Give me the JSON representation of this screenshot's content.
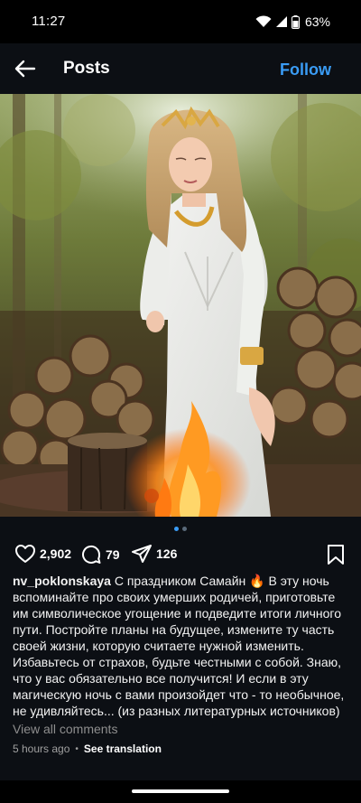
{
  "status_bar": {
    "time": "11:27",
    "battery": "63%",
    "icons": [
      "wifi-icon",
      "signal-icon",
      "battery-icon"
    ]
  },
  "header": {
    "back_icon": "arrow-left-icon",
    "title": "Posts",
    "follow_label": "Follow"
  },
  "post": {
    "image_subject": "woman-in-white-dress-by-fire",
    "carousel": {
      "total": 2,
      "active": 1
    },
    "actions": {
      "likes": "2,902",
      "comments": "79",
      "shares": "126",
      "like_icon": "heart-icon",
      "comment_icon": "comment-icon",
      "share_icon": "send-icon",
      "bookmark_icon": "bookmark-icon"
    },
    "caption": {
      "username": "nv_poklonskaya",
      "text": "С праздником Самайн 🔥 В эту ночь вспоминайте про своих умерших родичей, приготовьте им символическое угощение и подведите итоги личного пути. Постройте планы на будущее, измените ту часть своей жизни, которую считаете нужной изменить. Избавьтесь от страхов, будьте честными с собой. Знаю, что у вас обязательно все получится! И если в эту магическую ночь с вами произойдет что - то необычное, не удивляйтесь... (из разных литературных источников)"
    },
    "view_comments": "View all comments",
    "timestamp": "5 hours ago",
    "separator": "•",
    "translate": "See translation"
  },
  "colors": {
    "accent": "#3a9cf5",
    "background": "#0c0f14",
    "muted": "#8e8e8e"
  }
}
